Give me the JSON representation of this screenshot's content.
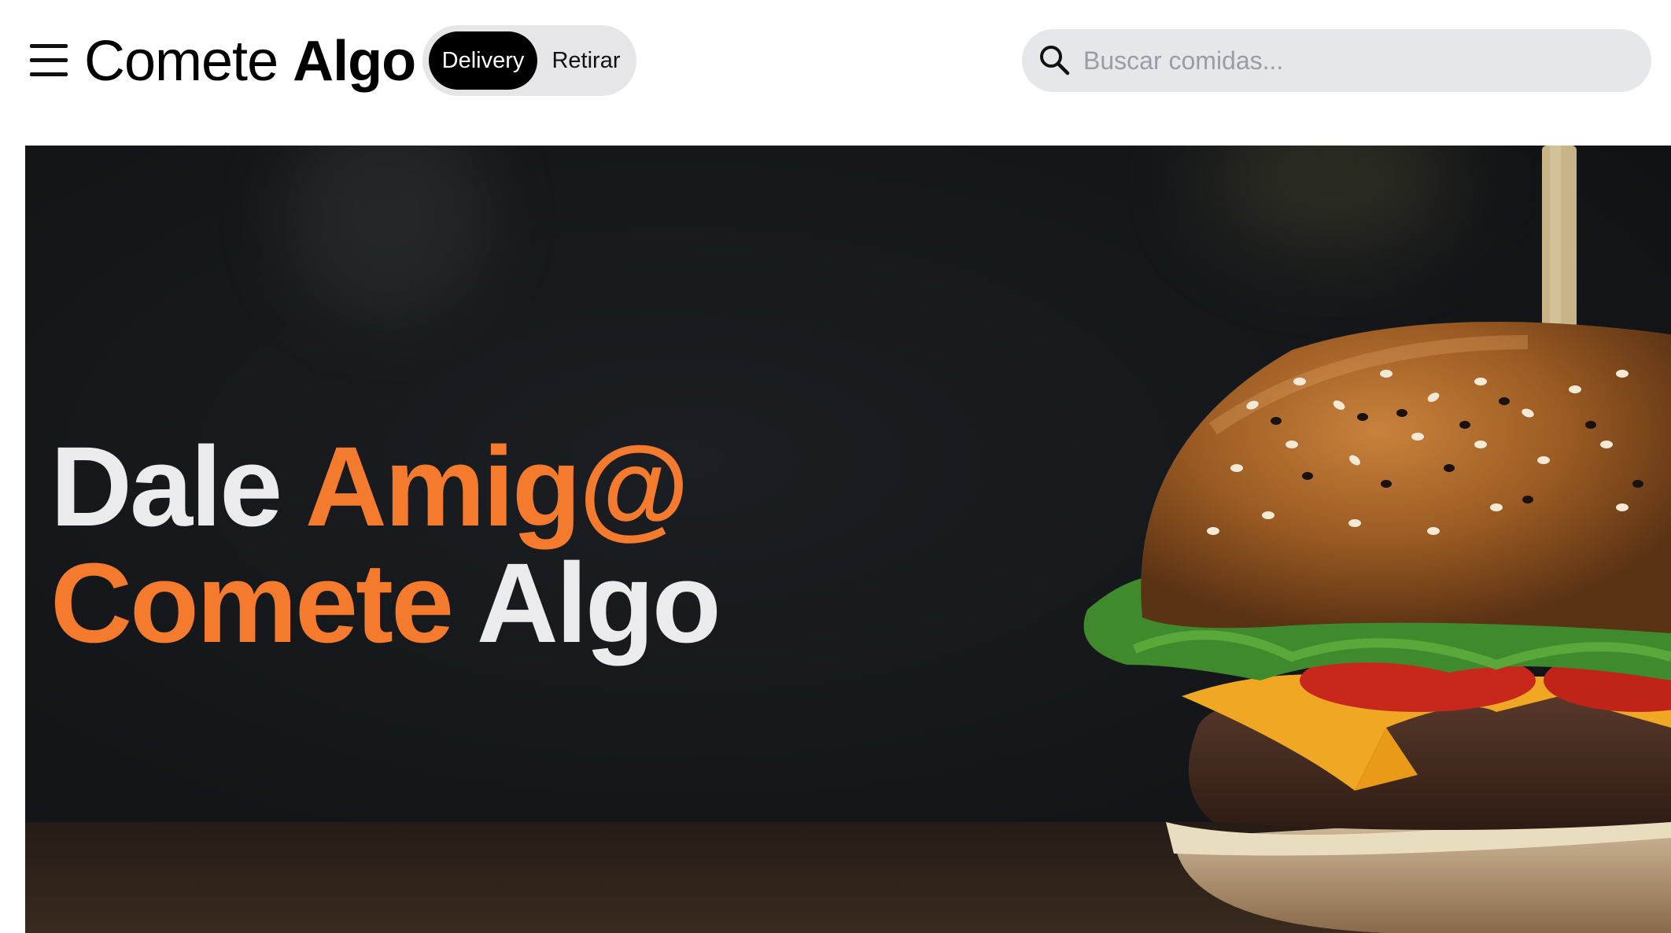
{
  "header": {
    "menu_icon": "hamburger-menu-icon",
    "brand_part1": "Comete",
    "brand_part2": "Algo",
    "modes": [
      {
        "label": "Delivery",
        "active": true
      },
      {
        "label": "Retirar",
        "active": false
      }
    ],
    "search": {
      "icon": "search-icon",
      "placeholder": "Buscar comidas...",
      "value": ""
    }
  },
  "hero": {
    "line1_white": "Dale",
    "line1_orange": "Amig@",
    "line2_orange": "Comete",
    "line2_white": "Algo",
    "image": "burger-photo",
    "accent_color": "#f47a2e"
  }
}
